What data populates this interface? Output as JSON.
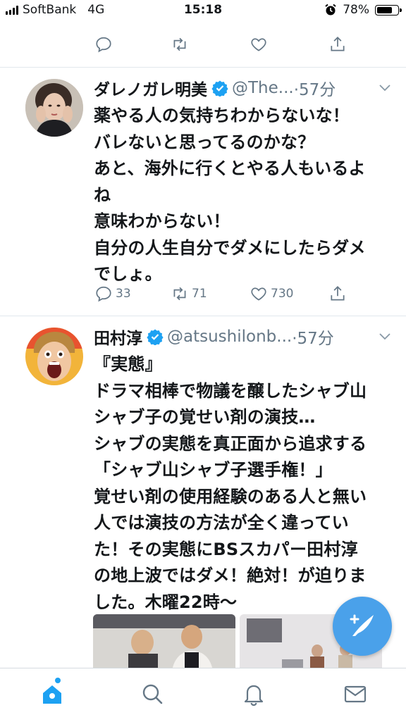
{
  "status_bar": {
    "carrier": "SoftBank",
    "network": "4G",
    "time": "15:18",
    "battery": "78%",
    "battery_level": 0.78
  },
  "top_actions": {
    "reply_icon": "reply-icon",
    "retweet_icon": "retweet-icon",
    "like_icon": "heart-icon",
    "share_icon": "share-icon"
  },
  "tweets": [
    {
      "name": "ダレノガレ明美",
      "verified": true,
      "handle": "@The...",
      "time": "·57分",
      "text": "薬やる人の気持ちわからないな！\nバレないと思ってるのかな？\nあと、海外に行くとやる人もいるよ\nね\n意味わからない！\n自分の人生自分でダメにしたらダメ\nでしょ。",
      "replies": "33",
      "retweets": "71",
      "likes": "730"
    },
    {
      "name": "田村淳",
      "verified": true,
      "handle": "@atsushilonb...",
      "time": "·57分",
      "text": "『実態』\nドラマ相棒で物議を醸したシャブ山\nシャブ子の覚せい剤の演技…\nシャブの実態を真正面から追求する\n「シャブ山シャブ子選手権！」\n覚せい剤の使用経験のある人と無い\n人では演技の方法が全く違ってい\nた！その実態にBSスカパー田村淳\nの地上波ではダメ！絶対！が迫りま\nした。木曜22時〜"
    }
  ],
  "fab": {
    "icon": "compose-icon"
  },
  "tab_bar": {
    "items": [
      "home-icon",
      "search-icon",
      "notifications-icon",
      "messages-icon"
    ]
  },
  "colors": {
    "accent": "#1da1f2",
    "fab": "#4aa1ea",
    "secondary_text": "#657786",
    "divider": "#e1e8ed"
  }
}
